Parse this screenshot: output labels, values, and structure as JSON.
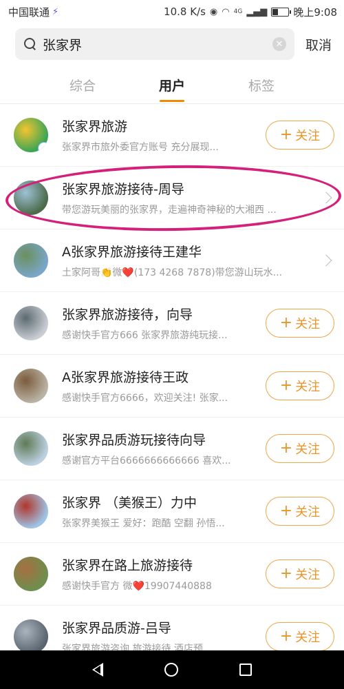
{
  "status_bar": {
    "carrier": "中国联通",
    "speed": "10.8 K/s",
    "signal": "4G",
    "time": "晚上9:08",
    "battery_level": 0.3
  },
  "search": {
    "query": "张家界",
    "cancel_label": "取消"
  },
  "tabs": [
    {
      "label": "综合"
    },
    {
      "label": "用户"
    },
    {
      "label": "标签"
    }
  ],
  "active_tab": "用户",
  "follow_label": "关注",
  "users": [
    {
      "name": "张家界旅游",
      "desc": "张家界市旅外委官方账号 充分展现...",
      "action": "follow",
      "verified": true,
      "avatar_colors": [
        "#3aa655",
        "#f4c430"
      ]
    },
    {
      "name": "张家界旅游接待-周导",
      "desc": "带您游玩美丽的张家界，走遍神奇神秘的大湘西 ...",
      "action": "chevron",
      "verified": false,
      "avatar_colors": [
        "#4b6b4a",
        "#9fc2d6"
      ]
    },
    {
      "name": "A张家界旅游接待王建华",
      "desc": "土家阿哥👏微❤️(173 4268 7878)带您游山玩水...",
      "action": "chevron",
      "verified": false,
      "avatar_colors": [
        "#7aa6c9",
        "#6b8f5e"
      ]
    },
    {
      "name": "张家界旅游接待，向导",
      "desc": "感谢快手官方666 张家界旅游纯玩接...",
      "action": "follow",
      "verified": false,
      "avatar_colors": [
        "#c8cdd2",
        "#5d6a72"
      ]
    },
    {
      "name": "A张家界旅游接待王政",
      "desc": "感谢快手官方6666，欢迎关注! 张家...",
      "action": "follow",
      "verified": false,
      "avatar_colors": [
        "#b9b3a4",
        "#7c5b3c"
      ]
    },
    {
      "name": "张家界品质游玩接待向导",
      "desc": "感谢官方平台6666666666666 喜欢...",
      "action": "follow",
      "verified": false,
      "avatar_colors": [
        "#bcd0e0",
        "#5e7a55"
      ]
    },
    {
      "name": "张家界 （美猴王）力中",
      "desc": "张家界美猴王 爱好：跑酷 空翻 孙悟...",
      "action": "follow",
      "verified": false,
      "avatar_colors": [
        "#9ec4e6",
        "#b0362b"
      ]
    },
    {
      "name": "张家界在路上旅游接待",
      "desc": "感谢快手官方 微❤️19907440888",
      "action": "follow",
      "verified": false,
      "avatar_colors": [
        "#6d8f50",
        "#a66f3f"
      ]
    },
    {
      "name": "张家界品质游-吕导",
      "desc": "张家界旅游咨询 旅游接待 酒店预...",
      "action": "follow",
      "verified": false,
      "avatar_colors": [
        "#5a6470",
        "#a9b4bd"
      ]
    }
  ]
}
